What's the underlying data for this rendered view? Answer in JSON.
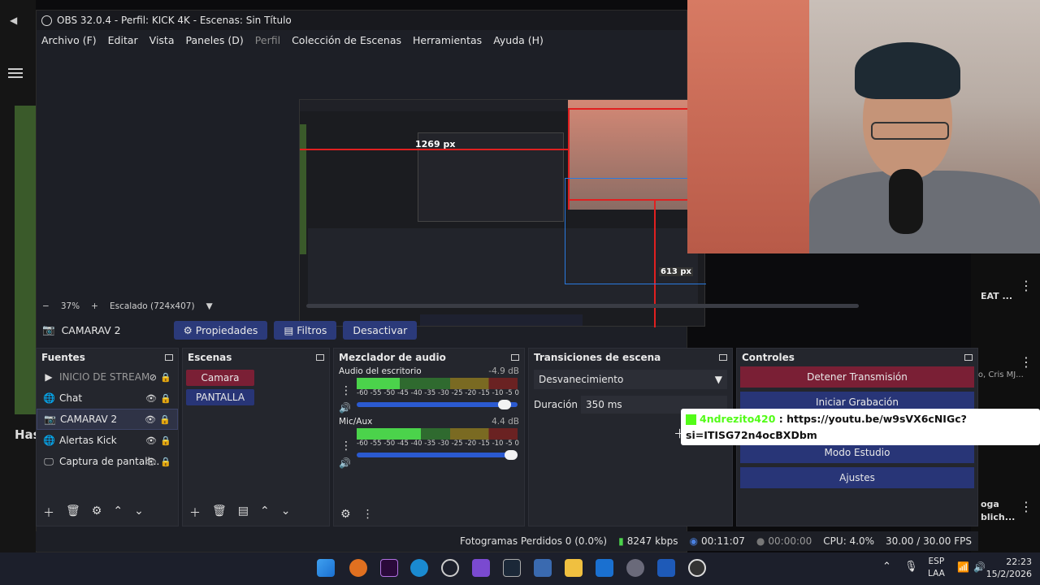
{
  "window": {
    "title": "OBS 32.0.4 - Perfil: KICK 4K - Escenas: Sin Título"
  },
  "menu": [
    "Archivo (F)",
    "Editar",
    "Vista",
    "Paneles (D)",
    "Perfil",
    "Colección de Escenas",
    "Herramientas",
    "Ayuda (H)"
  ],
  "preview": {
    "measure_h": "1269 px",
    "measure_v": "613 px",
    "zoom_minus": "−",
    "zoom": "37%",
    "zoom_plus": "+",
    "scale": "Escalado (724x407)"
  },
  "source_bar": {
    "selected": "CAMARAV 2",
    "properties": "Propiedades",
    "filters": "Filtros",
    "deactivate": "Desactivar"
  },
  "panels": {
    "sources": {
      "title": "Fuentes",
      "items": [
        {
          "label": "INICIO DE STREAM",
          "icon": "play-icon"
        },
        {
          "label": "Chat",
          "icon": "browser-icon"
        },
        {
          "label": "CAMARAV 2",
          "icon": "camera-icon"
        },
        {
          "label": "Alertas Kick",
          "icon": "browser-icon"
        },
        {
          "label": "Captura de pantall...",
          "icon": "monitor-icon"
        }
      ]
    },
    "scenes": {
      "title": "Escenas",
      "items": [
        "Camara",
        "PANTALLA"
      ]
    },
    "mixer": {
      "title": "Mezclador de audio",
      "channels": [
        {
          "name": "Audio del escritorio",
          "db": "-4.9 dB",
          "level": 0.27
        },
        {
          "name": "Mic/Aux",
          "db": "4.4 dB",
          "level": 0.4
        }
      ],
      "scale": [
        "-60",
        "-55",
        "-50",
        "-45",
        "-40",
        "-35",
        "-30",
        "-25",
        "-20",
        "-15",
        "-10",
        "-5",
        "0"
      ]
    },
    "transitions": {
      "title": "Transiciones de escena",
      "selected": "Desvanecimiento",
      "duration_label": "Duración",
      "duration_value": "350 ms"
    },
    "controls": {
      "title": "Controles",
      "stop_stream": "Detener Transmisión",
      "start_record": "Iniciar Grabación",
      "studio_mode": "Modo Estudio",
      "settings": "Ajustes"
    }
  },
  "status": {
    "dropped": "Fotogramas Perdidos 0 (0.0%)",
    "bitrate": "8247 kbps",
    "live_time": "00:11:07",
    "rec_time": "00:00:00",
    "cpu": "CPU: 4.0%",
    "fps": "30.00 / 30.00 FPS"
  },
  "chat": {
    "user": "4ndrezito420",
    "message": ": https://youtu.be/w9sVX6cNIGc?si=ITISG72n4ocBXDbm"
  },
  "taskbar": {
    "lang_1": "ESP",
    "lang_2": "LAA",
    "time": "22:23",
    "date": "15/2/2026"
  },
  "background": {
    "snippet_1": "EAT ...",
    "snippet_2": "to, Cris MJ...",
    "snippet_3": "Has",
    "snippet_4": "oga",
    "snippet_5": "blich..."
  },
  "colors": {
    "accent_blue": "#283577",
    "stop_red": "#7a1f35",
    "kick_green": "#53fc18"
  }
}
